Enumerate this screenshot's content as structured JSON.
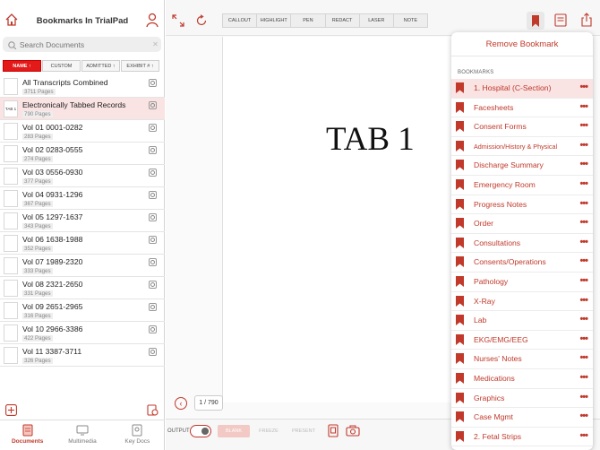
{
  "sidebar": {
    "title": "Bookmarks In TrialPad",
    "search_placeholder": "Search Documents",
    "sort_buttons": [
      "NAME ↑",
      "CUSTOM",
      "ADMITTED ↑",
      "EXHIBIT # ↑"
    ],
    "documents": [
      {
        "name": "All Transcripts Combined",
        "pages": "3711 Pages",
        "thumb": ""
      },
      {
        "name": "Electronically Tabbed Records",
        "pages": "790 Pages",
        "thumb": "TAB 1"
      },
      {
        "name": "Vol 01 0001-0282",
        "pages": "283 Pages",
        "thumb": ""
      },
      {
        "name": "Vol 02 0283-0555",
        "pages": "274 Pages",
        "thumb": ""
      },
      {
        "name": "Vol 03 0556-0930",
        "pages": "377 Pages",
        "thumb": ""
      },
      {
        "name": "Vol 04 0931-1296",
        "pages": "367 Pages",
        "thumb": ""
      },
      {
        "name": "Vol 05 1297-1637",
        "pages": "343 Pages",
        "thumb": ""
      },
      {
        "name": "Vol 06 1638-1988",
        "pages": "352 Pages",
        "thumb": ""
      },
      {
        "name": "Vol 07 1989-2320",
        "pages": "333 Pages",
        "thumb": ""
      },
      {
        "name": "Vol 08 2321-2650",
        "pages": "331 Pages",
        "thumb": ""
      },
      {
        "name": "Vol 09 2651-2965",
        "pages": "316 Pages",
        "thumb": ""
      },
      {
        "name": "Vol 10 2966-3386",
        "pages": "422 Pages",
        "thumb": ""
      },
      {
        "name": "Vol 11 3387-3711",
        "pages": "326 Pages",
        "thumb": ""
      }
    ],
    "tabs": [
      "Documents",
      "Multimedia",
      "Key Docs"
    ]
  },
  "toolbar": {
    "tools": [
      "CALLOUT",
      "HIGHLIGHT",
      "PEN",
      "REDACT",
      "LASER",
      "NOTE"
    ]
  },
  "viewer": {
    "page_text": "TAB 1",
    "page_counter": "1 / 790",
    "output_label": "OUTPUT",
    "modes": [
      "BLANK",
      "FREEZE",
      "PRESENT"
    ]
  },
  "popover": {
    "remove_label": "Remove Bookmark",
    "section_title": "BOOKMARKS",
    "bookmarks": [
      "1. Hospital (C-Section)",
      "Facesheets",
      "Consent Forms",
      "Admission/History & Physical",
      "Discharge Summary",
      "Emergency Room",
      "Progress Notes",
      "Order",
      "Consultations",
      "Consents/Operations",
      "Pathology",
      "X-Ray",
      "Lab",
      "EKG/EMG/EEG",
      "Nurses' Notes",
      "Medications",
      "Graphics",
      "Case Mgmt",
      "2. Fetal Strips"
    ],
    "more_glyph": "•••"
  },
  "colors": {
    "accent": "#c0392b",
    "active_sort": "#e31a1a",
    "selected_row": "#f9e3e3"
  }
}
